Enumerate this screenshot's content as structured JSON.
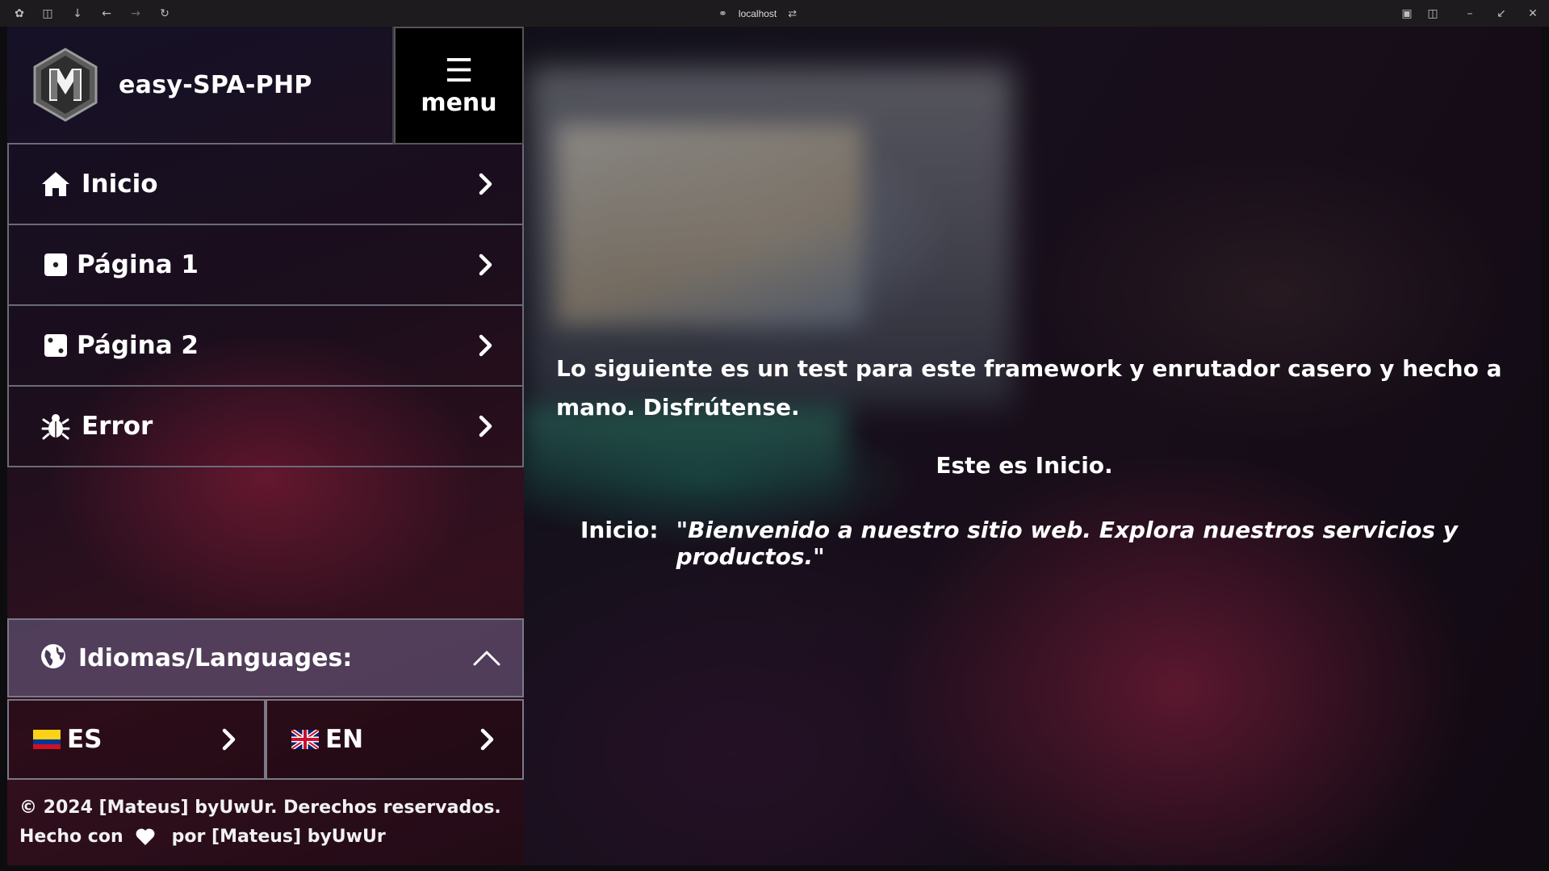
{
  "browser": {
    "url": "localhost"
  },
  "sidebar": {
    "brand_name": "easy-SPA-PHP",
    "menu_button": {
      "label": "menu"
    },
    "nav_items": [
      {
        "label": "Inicio",
        "icon": "home-icon"
      },
      {
        "label": "Página 1",
        "icon": "dice-one-icon"
      },
      {
        "label": "Página 2",
        "icon": "dice-two-icon"
      },
      {
        "label": "Error",
        "icon": "bug-icon"
      }
    ],
    "languages": {
      "header": "Idiomas/Languages:",
      "icon": "globe-icon",
      "options": [
        {
          "label": "ES",
          "flag": "colombia-flag-icon"
        },
        {
          "label": "EN",
          "flag": "uk-flag-icon"
        }
      ]
    },
    "footer": {
      "copyright": "© 2024 [Mateus] byUwUr. Derechos reservados.",
      "made_with": "Hecho con",
      "made_by": "por [Mateus] byUwUr"
    }
  },
  "main": {
    "intro": "Lo siguiente es un test para este framework y enrutador casero y hecho a mano. Disfrútense.",
    "page_title": "Este es Inicio.",
    "quote_label": "Inicio:",
    "quote_text": "\"Bienvenido a nuestro sitio web. Explora nuestros servicios y productos.\""
  },
  "colors": {
    "menu_button_bg": "#000000",
    "language_header_bg": "#6e648c",
    "text": "#ffffff"
  }
}
